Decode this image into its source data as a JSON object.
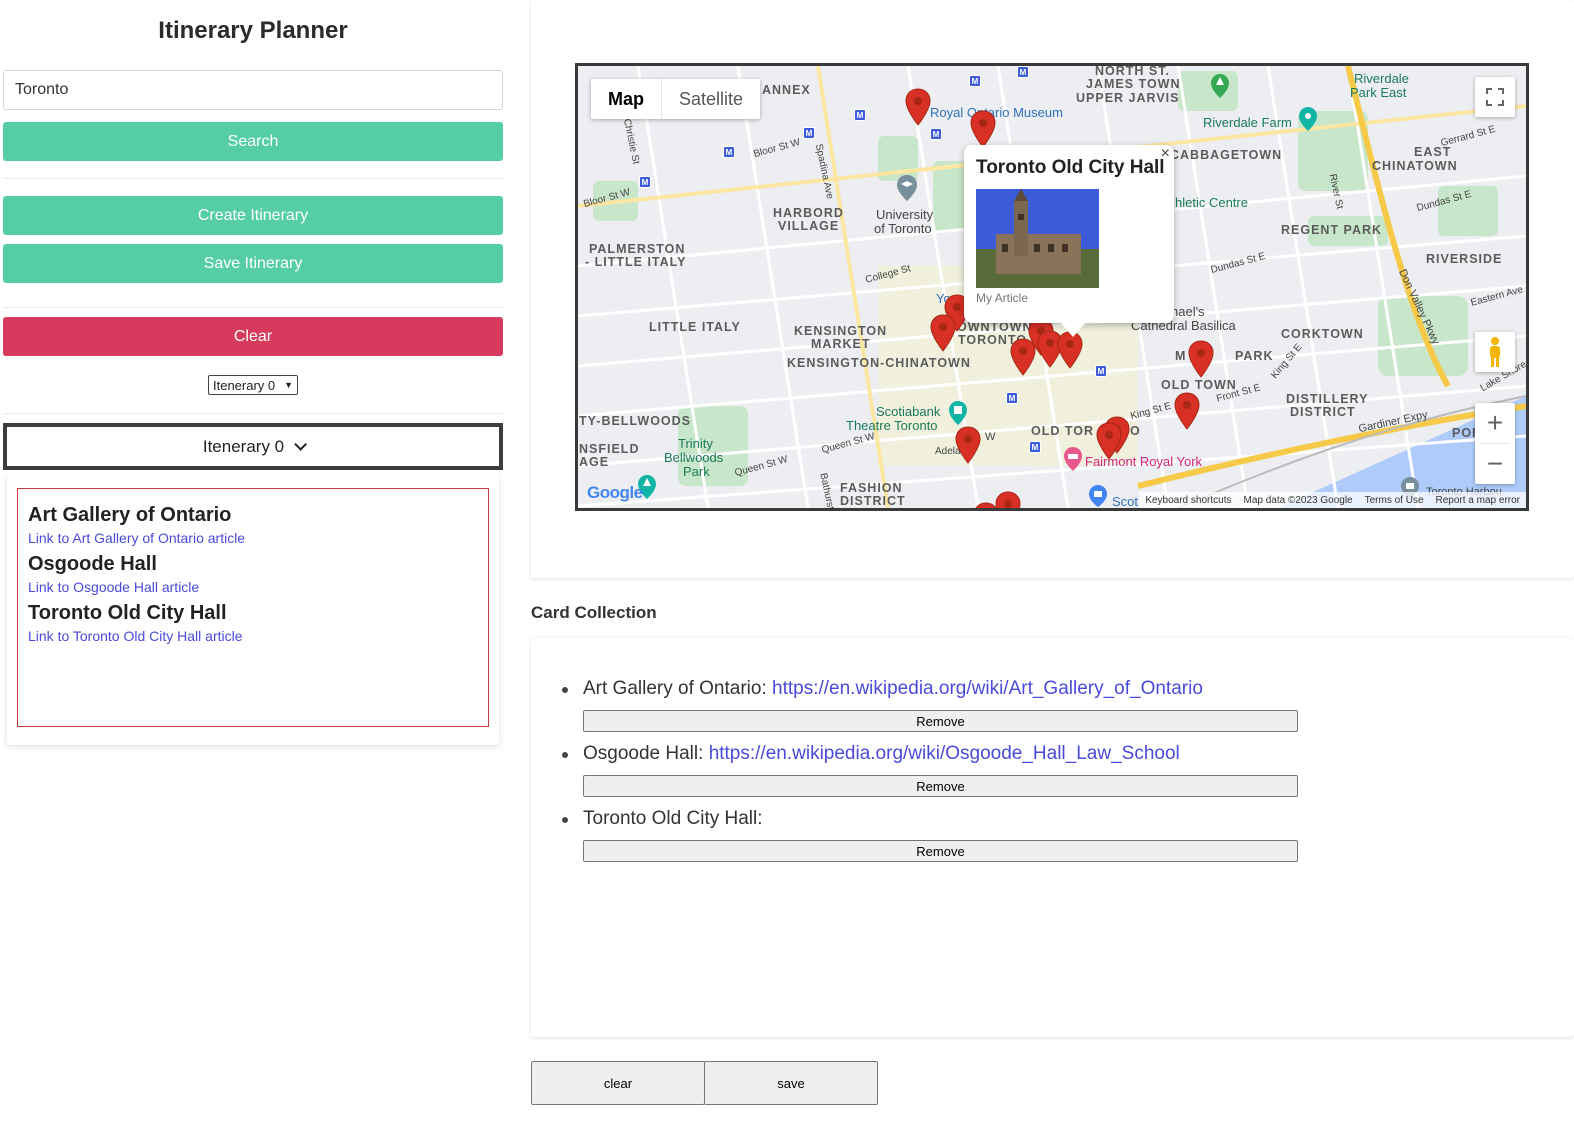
{
  "sidebar": {
    "title": "Itinerary Planner",
    "search_value": "Toronto",
    "search_button": "Search",
    "create_button": "Create Itinerary",
    "save_button": "Save Itinerary",
    "clear_button": "Clear",
    "select_value": "Itenerary 0",
    "dropdown_label": "Itenerary 0",
    "items": [
      {
        "title": "Art Gallery of Ontario",
        "link": "Link to Art Gallery of Ontario article"
      },
      {
        "title": "Osgoode Hall",
        "link": "Link to Osgoode Hall article"
      },
      {
        "title": "Toronto Old City Hall",
        "link": "Link to Toronto Old City Hall article"
      }
    ]
  },
  "map": {
    "type_map": "Map",
    "type_satellite": "Satellite",
    "infowindow": {
      "title": "Toronto Old City Hall",
      "caption": "My Article",
      "close": "×"
    },
    "labels": {
      "annex": "ANNEX",
      "north_st": "NORTH ST.",
      "james_town": "JAMES TOWN",
      "upper_jarvis": "UPPER JARVIS",
      "riverdale_park": "Riverdale",
      "riverdale_park2": "Park East",
      "rom": "Royal Ontario Museum",
      "riverdale_farm": "Riverdale Farm",
      "cabbagetown": "CABBAGETOWN",
      "east_chinatown": "EAST",
      "east_chinatown2": "CHINATOWN",
      "harbord": "HARBORD",
      "harbord2": "VILLAGE",
      "uoft": "University",
      "uoft2": "of Toronto",
      "athletic": "hletic Centre",
      "regent_park": "REGENT PARK",
      "palmerston": "PALMERSTON",
      "little_italy_top": "- LITTLE ITALY",
      "riverside": "RIVERSIDE",
      "little_italy": "LITTLE ITALY",
      "kensington": "KENSINGTON",
      "market": "MARKET",
      "kensington_chinatown": "KENSINGTON-CHINATOWN",
      "downtown": "OWNTOWN",
      "toronto": "TORONTO",
      "cathedral": "hael's",
      "cathedral2": "Cathedral Basilica",
      "corktown": "CORKTOWN",
      "moss_park": "PARK",
      "old_town": "OLD TOWN",
      "distillery": "DISTILLERY",
      "distillery2": "DISTRICT",
      "bellwoods": "TY-BELLWOODS",
      "scotiabank": "Scotiabank",
      "scotiabank2": "Theatre Toronto",
      "trinity": "Trinity",
      "trinity2": "Bellwoods",
      "trinity3": "Park",
      "old_toronto": "OLD TOR",
      "old_toronto2": "O",
      "fairmont": "Fairmont Royal York",
      "nsfield": "NSFIELD",
      "age": "AGE",
      "fashion": "FASHION",
      "fashion2": "DISTRICT",
      "scot": "Scot",
      "port": "POR",
      "toronto_harbour": "Toronto Harbou",
      "gardiner": "Gardiner Expy",
      "lake_shore": "Lake Shore",
      "don_valley": "Don Valley Pkwy",
      "bloor_st_w": "Bloor St W",
      "bloor_st_w2": "Bloor St W",
      "college": "College St",
      "dundas_e": "Dundas St E",
      "dundas_e2": "Dundas St E",
      "queen_w": "Queen St W",
      "queen_w2": "Queen St W",
      "king_e": "King St E",
      "front_e": "Front St E",
      "gerrard": "Gerrard St E",
      "eastern": "Eastern Ave",
      "king_e2": "King St E",
      "spadina": "Spadina Ave",
      "christie": "Christie St",
      "bathurst": "Bathurst",
      "river_st": "River St",
      "adela": "Adela",
      "yo": "Yo",
      "m_label": "M",
      "w_label": "W"
    },
    "footer": {
      "shortcuts": "Keyboard shortcuts",
      "data": "Map data ©2023 Google",
      "terms": "Terms of Use",
      "report": "Report a map error"
    },
    "google": "Google"
  },
  "collection": {
    "title": "Card Collection",
    "cards": [
      {
        "name": "Art Gallery of Ontario:",
        "url": "https://en.wikipedia.org/wiki/Art_Gallery_of_Ontario",
        "remove": "Remove"
      },
      {
        "name": "Osgoode Hall:",
        "url": "https://en.wikipedia.org/wiki/Osgoode_Hall_Law_School",
        "remove": "Remove"
      },
      {
        "name": "Toronto Old City Hall:",
        "url": "",
        "remove": "Remove"
      }
    ],
    "clear_button": "clear",
    "save_button": "save"
  }
}
